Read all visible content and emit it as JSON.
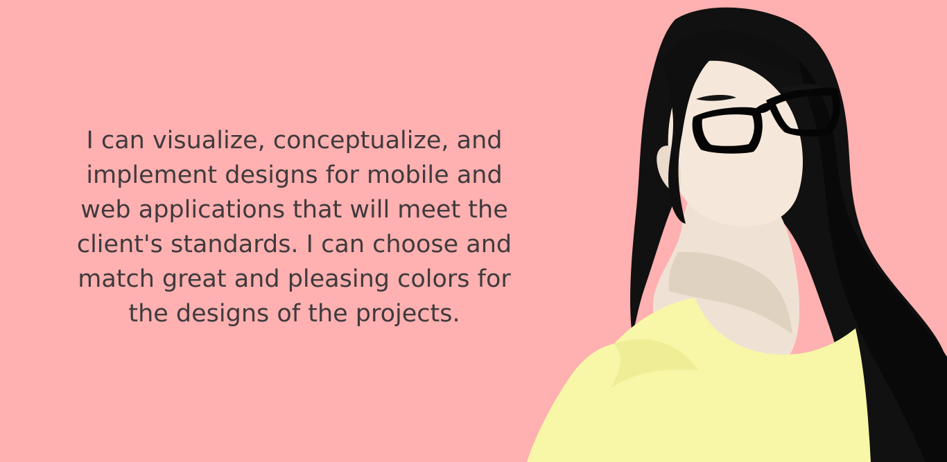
{
  "intro": {
    "lines": [
      "I can visualize, conceptualize, and",
      "implement designs for mobile and",
      "web applications that will meet the",
      "client's standards. I can choose and",
      "match great and pleasing colors for",
      "the designs of the projects."
    ]
  },
  "colors": {
    "background": "#ffb0b0",
    "text": "#3f3a3d",
    "hair": "#111111",
    "skin": "#f5e8da",
    "shadow": "#e6d8c8",
    "shirt": "#f8f7a8",
    "glasses": "#050505"
  },
  "illustration": {
    "subject": "woman-with-glasses"
  }
}
